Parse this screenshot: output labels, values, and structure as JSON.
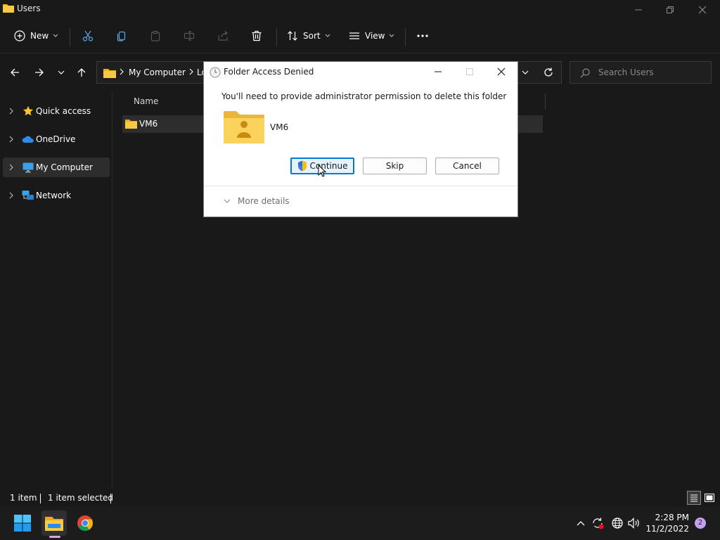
{
  "window": {
    "title": "Users"
  },
  "toolbar": {
    "new_label": "New",
    "sort_label": "Sort",
    "view_label": "View"
  },
  "address": {
    "crumbs": [
      "My Computer",
      "Lo"
    ]
  },
  "search": {
    "placeholder": "Search Users"
  },
  "nav": {
    "items": [
      {
        "label": "Quick access",
        "icon": "star-icon",
        "selected": false
      },
      {
        "label": "OneDrive",
        "icon": "cloud-icon",
        "selected": false
      },
      {
        "label": "My Computer",
        "icon": "monitor-icon",
        "selected": true
      },
      {
        "label": "Network",
        "icon": "network-icon",
        "selected": false
      }
    ]
  },
  "filelist": {
    "column_name": "Name",
    "rows": [
      {
        "name": "VM6",
        "selected": true
      }
    ]
  },
  "statusbar": {
    "item_count": "1 item",
    "selected_count": "1 item selected"
  },
  "taskbar": {
    "time": "2:28 PM",
    "date": "11/2/2022",
    "notification_count": "2"
  },
  "dialog": {
    "title": "Folder Access Denied",
    "message": "You'll need to provide administrator permission to delete this folder",
    "item_name": "VM6",
    "continue_label": "Continue",
    "skip_label": "Skip",
    "cancel_label": "Cancel",
    "more_details_label": "More details"
  },
  "colors": {
    "background": "#191919",
    "accent": "#0078d4",
    "folder": "#f8c847",
    "dialog_bg": "#ffffff"
  }
}
